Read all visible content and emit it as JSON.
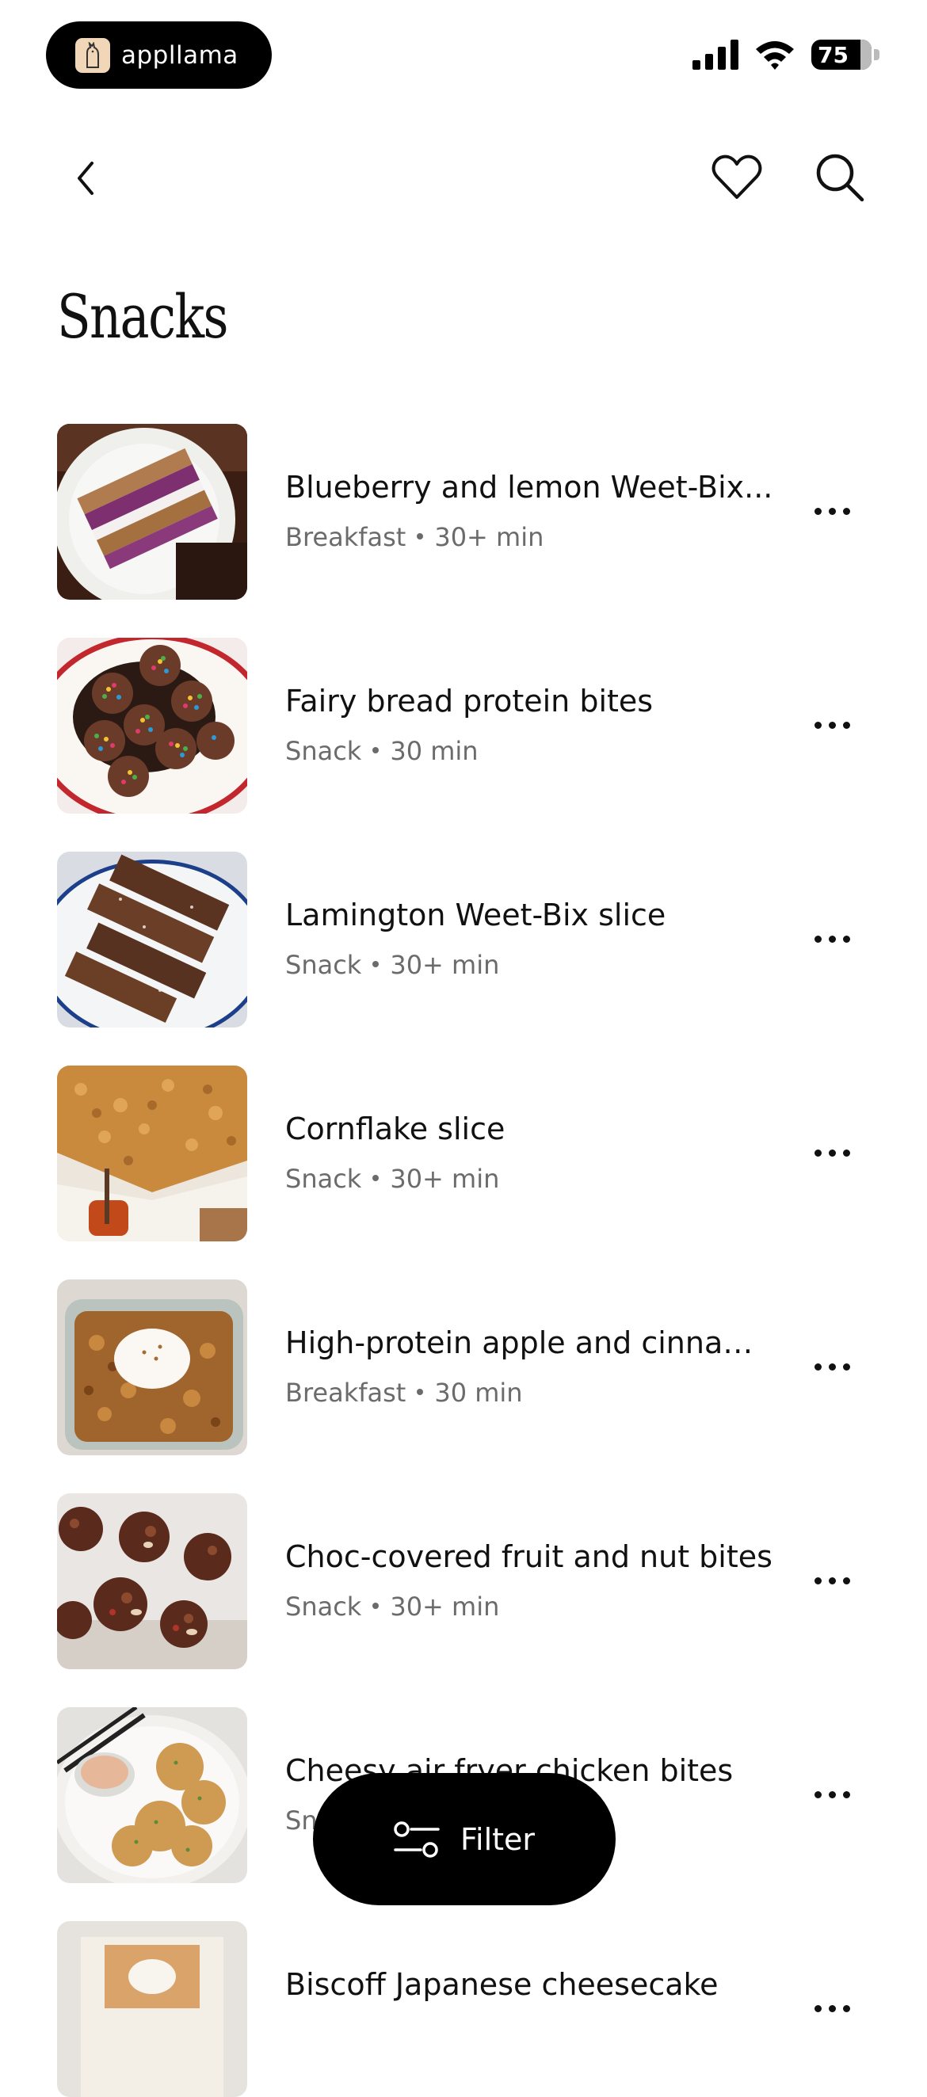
{
  "status_bar": {
    "app_name": "appllama",
    "battery": "75"
  },
  "nav": {
    "back_icon": "chevron-left-icon",
    "favorite_icon": "heart-icon",
    "search_icon": "search-icon"
  },
  "page": {
    "title": "Snacks"
  },
  "recipes": [
    {
      "title": "Blueberry and lemon Weet-Bix...",
      "category": "Breakfast",
      "time": "30+ min"
    },
    {
      "title": "Fairy bread protein bites",
      "category": "Snack",
      "time": "30 min"
    },
    {
      "title": "Lamington Weet-Bix slice",
      "category": "Snack",
      "time": "30+ min"
    },
    {
      "title": "Cornflake slice",
      "category": "Snack",
      "time": "30+ min"
    },
    {
      "title": "High-protein apple and cinnam...",
      "category": "Breakfast",
      "time": "30 min"
    },
    {
      "title": "Choc-covered fruit and nut bites",
      "category": "Snack",
      "time": "30+ min"
    },
    {
      "title": "Cheesy air fryer chicken bites",
      "category": "Snack",
      "time": ""
    },
    {
      "title": "Biscoff Japanese cheesecake",
      "category": "",
      "time": ""
    }
  ],
  "filter": {
    "label": "Filter",
    "icon": "sliders-icon"
  }
}
